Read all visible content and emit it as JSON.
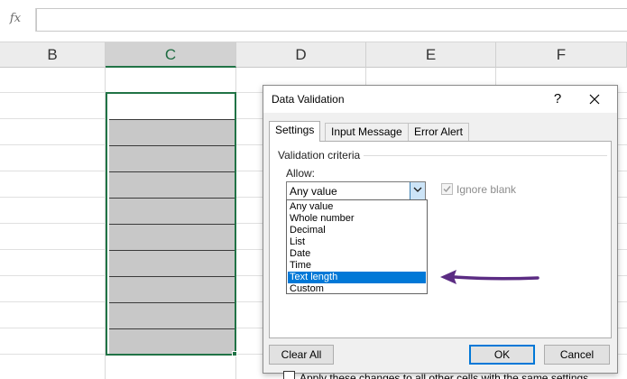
{
  "formula_bar": {
    "fx_label": "fx",
    "value": ""
  },
  "columns": [
    {
      "label": "B",
      "selected": false
    },
    {
      "label": "C",
      "selected": true
    },
    {
      "label": "D",
      "selected": false
    },
    {
      "label": "E",
      "selected": false
    },
    {
      "label": "F",
      "selected": false
    }
  ],
  "dialog": {
    "title": "Data Validation",
    "help_label": "?",
    "tabs": [
      {
        "label": "Settings",
        "active": true
      },
      {
        "label": "Input Message",
        "active": false
      },
      {
        "label": "Error Alert",
        "active": false
      }
    ],
    "group_label": "Validation criteria",
    "allow_label": "Allow:",
    "allow_value": "Any value",
    "ignore_blank_label": "Ignore blank",
    "ignore_blank_checked": true,
    "allow_options": [
      "Any value",
      "Whole number",
      "Decimal",
      "List",
      "Date",
      "Time",
      "Text length",
      "Custom"
    ],
    "highlighted_option": "Text length",
    "apply_label": "Apply these changes to all other cells with the same settings",
    "apply_checked": false,
    "clear_all_label": "Clear All",
    "ok_label": "OK",
    "cancel_label": "Cancel"
  },
  "colors": {
    "selection_green": "#217346",
    "highlight_blue": "#0078d7",
    "annotation_arrow": "#5b2c83",
    "filled_cell_gray": "#c8c8c8"
  }
}
